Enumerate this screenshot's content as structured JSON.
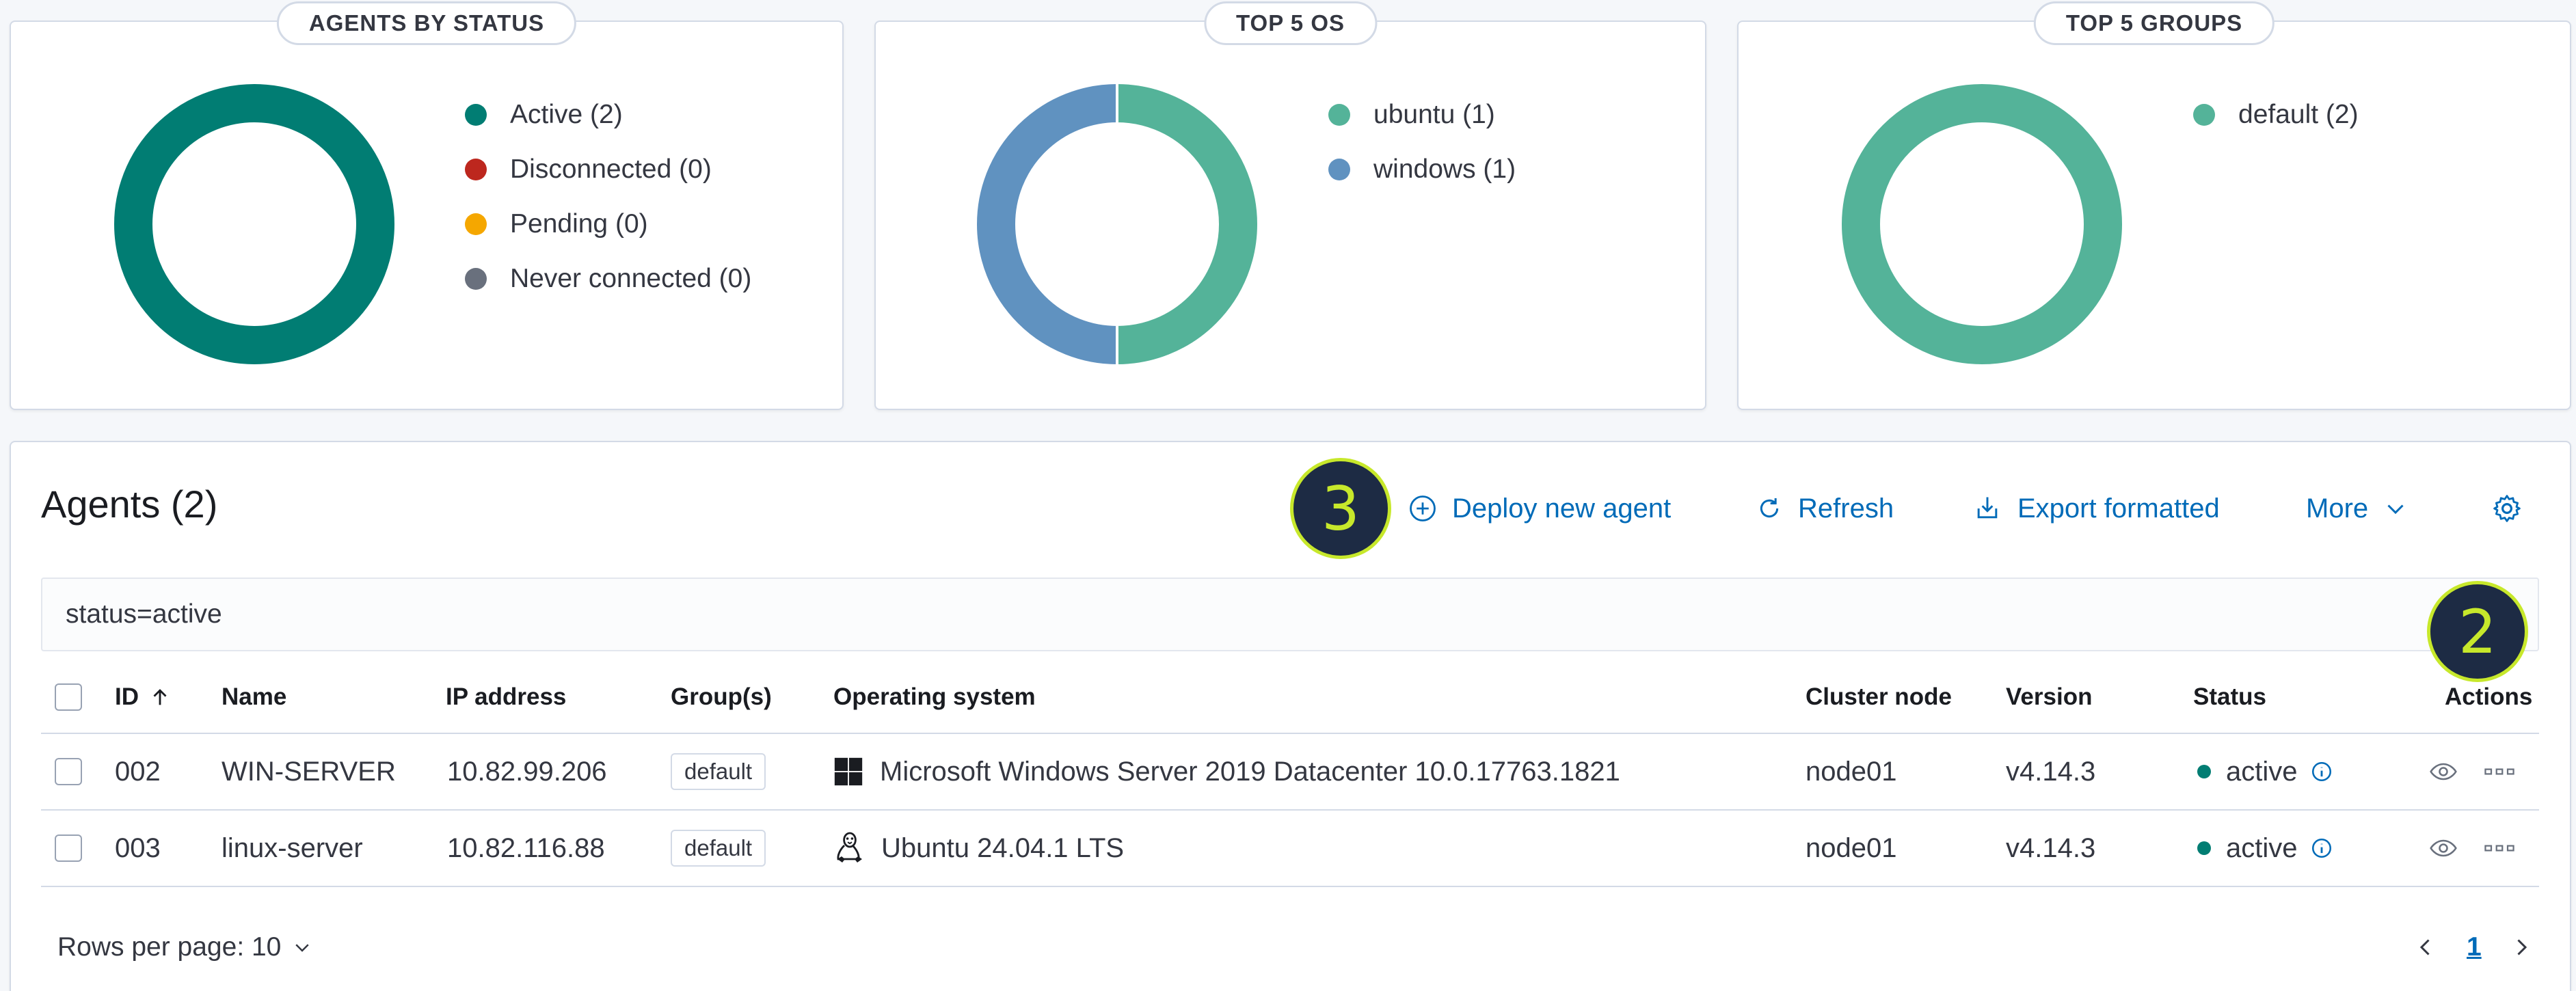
{
  "colors": {
    "active": "#017d73",
    "disconnected": "#bd271e",
    "pending": "#f5a700",
    "never_connected": "#69707d",
    "ubuntu": "#54b399",
    "windows": "#6092c0",
    "default_group": "#54b399",
    "link": "#006bb8",
    "badge_bg": "#1d2b44",
    "badge_fg": "#c7e82b"
  },
  "status_card": {
    "title": "AGENTS BY STATUS",
    "legend": [
      {
        "label": "Active (2)",
        "color": "#017d73",
        "value": 2
      },
      {
        "label": "Disconnected (0)",
        "color": "#bd271e",
        "value": 0
      },
      {
        "label": "Pending (0)",
        "color": "#f5a700",
        "value": 0
      },
      {
        "label": "Never connected (0)",
        "color": "#69707d",
        "value": 0
      }
    ]
  },
  "os_card": {
    "title": "TOP 5 OS",
    "legend": [
      {
        "label": "ubuntu (1)",
        "color": "#54b399",
        "value": 1
      },
      {
        "label": "windows (1)",
        "color": "#6092c0",
        "value": 1
      }
    ]
  },
  "groups_card": {
    "title": "TOP 5 GROUPS",
    "legend": [
      {
        "label": "default (2)",
        "color": "#54b399",
        "value": 2
      }
    ]
  },
  "agents": {
    "title": "Agents (2)",
    "toolbar": {
      "deploy": "Deploy new agent",
      "refresh": "Refresh",
      "export": "Export formatted",
      "more": "More"
    },
    "search_value": "status=active",
    "columns": {
      "id": "ID",
      "name": "Name",
      "ip": "IP address",
      "groups": "Group(s)",
      "os": "Operating system",
      "cluster": "Cluster node",
      "version": "Version",
      "status": "Status",
      "actions": "Actions"
    },
    "rows": [
      {
        "id": "002",
        "name": "WIN-SERVER",
        "ip": "10.82.99.206",
        "group": "default",
        "os_icon": "windows-icon",
        "os": "Microsoft Windows Server 2019 Datacenter 10.0.17763.1821",
        "cluster": "node01",
        "version": "v4.14.3",
        "status": "active"
      },
      {
        "id": "003",
        "name": "linux-server",
        "ip": "10.82.116.88",
        "group": "default",
        "os_icon": "linux-icon",
        "os": "Ubuntu 24.04.1 LTS",
        "cluster": "node01",
        "version": "v4.14.3",
        "status": "active"
      }
    ],
    "pagination": {
      "rows_per_page": "Rows per page: 10",
      "current_page": "1"
    }
  },
  "callouts": {
    "deploy_badge": "3",
    "actions_badge": "2"
  }
}
